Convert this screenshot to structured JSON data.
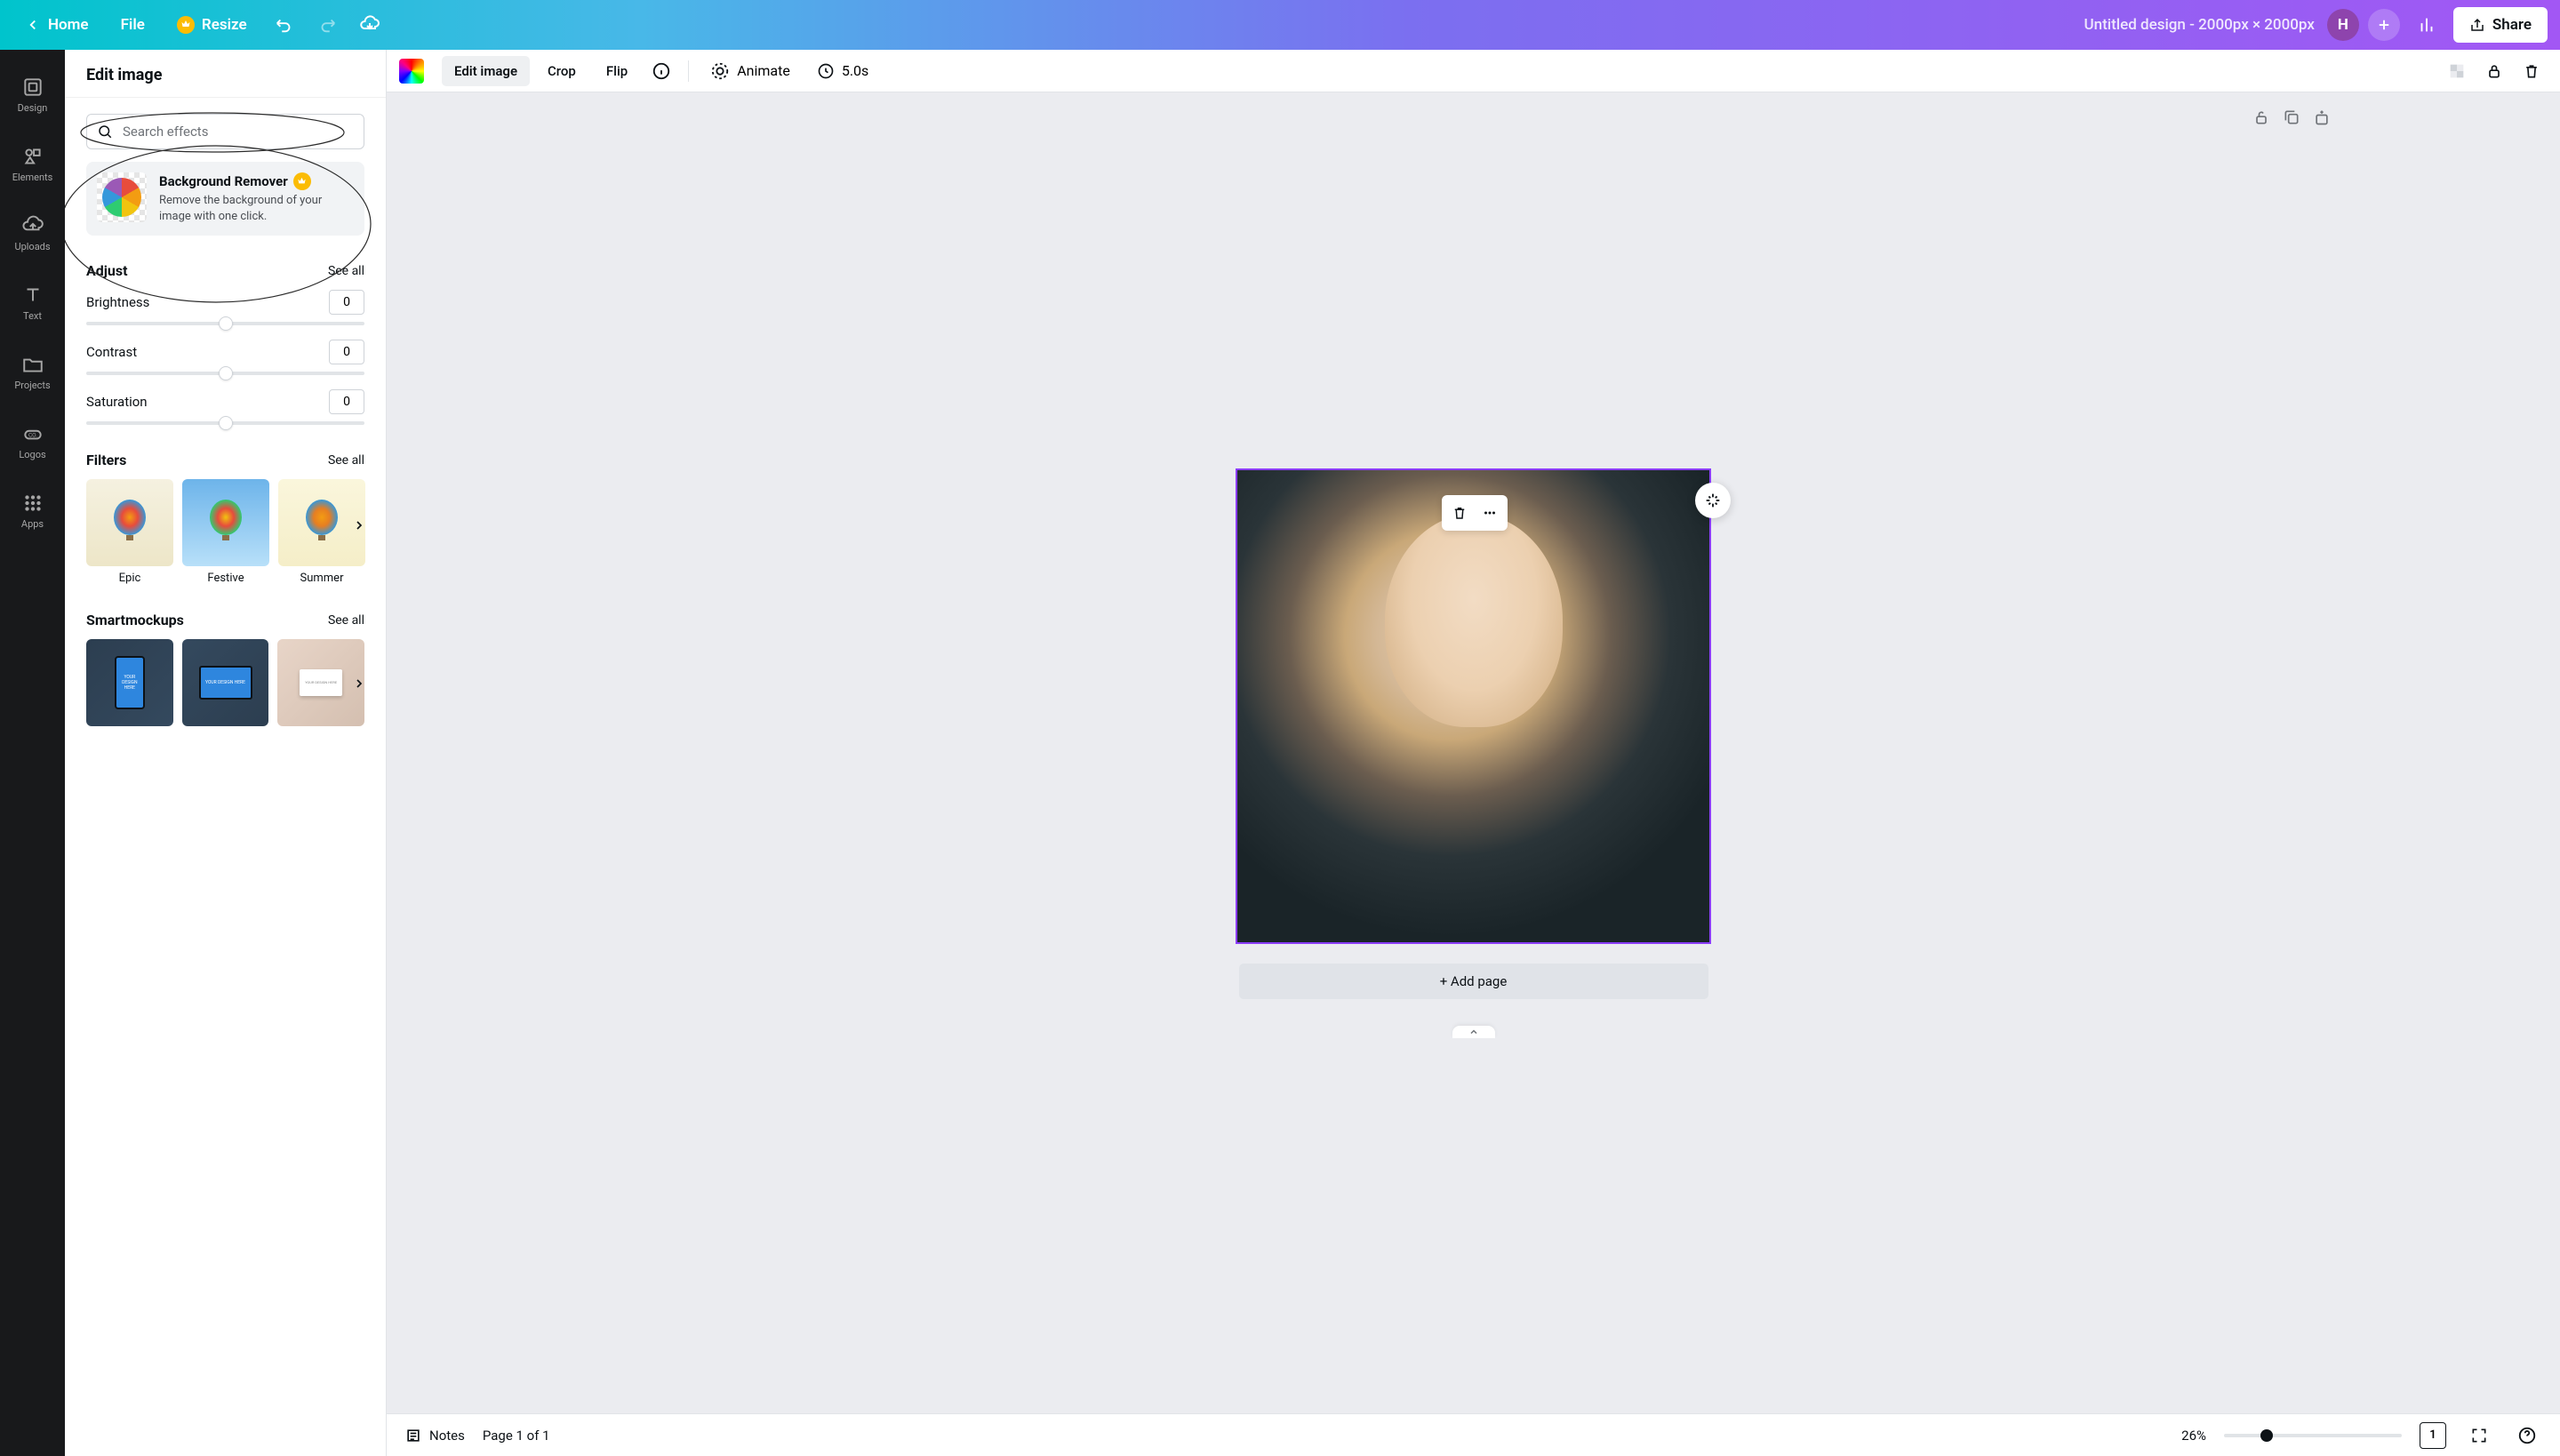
{
  "header": {
    "home": "Home",
    "file": "File",
    "resize": "Resize",
    "doc_title": "Untitled design - 2000px × 2000px",
    "share": "Share",
    "avatar_initial": "H"
  },
  "nav": {
    "items": [
      {
        "label": "Design"
      },
      {
        "label": "Elements"
      },
      {
        "label": "Uploads"
      },
      {
        "label": "Text"
      },
      {
        "label": "Projects"
      },
      {
        "label": "Logos"
      },
      {
        "label": "Apps"
      }
    ]
  },
  "panel": {
    "title": "Edit image",
    "search_placeholder": "Search effects",
    "bg_remover": {
      "title": "Background Remover",
      "desc": "Remove the background of your image with one click."
    },
    "adjust": {
      "title": "Adjust",
      "see_all": "See all",
      "controls": [
        {
          "label": "Brightness",
          "value": "0"
        },
        {
          "label": "Contrast",
          "value": "0"
        },
        {
          "label": "Saturation",
          "value": "0"
        }
      ]
    },
    "filters": {
      "title": "Filters",
      "see_all": "See all",
      "items": [
        {
          "name": "Epic"
        },
        {
          "name": "Festive"
        },
        {
          "name": "Summer"
        }
      ]
    },
    "smartmockups": {
      "title": "Smartmockups",
      "see_all": "See all",
      "your_design_here": "YOUR DESIGN HERE"
    }
  },
  "context_toolbar": {
    "edit_image": "Edit image",
    "crop": "Crop",
    "flip": "Flip",
    "animate": "Animate",
    "timing": "5.0s"
  },
  "canvas": {
    "add_page": "+ Add page"
  },
  "bottom": {
    "notes": "Notes",
    "page_info": "Page 1 of 1",
    "zoom": "26%",
    "page_badge": "1"
  }
}
